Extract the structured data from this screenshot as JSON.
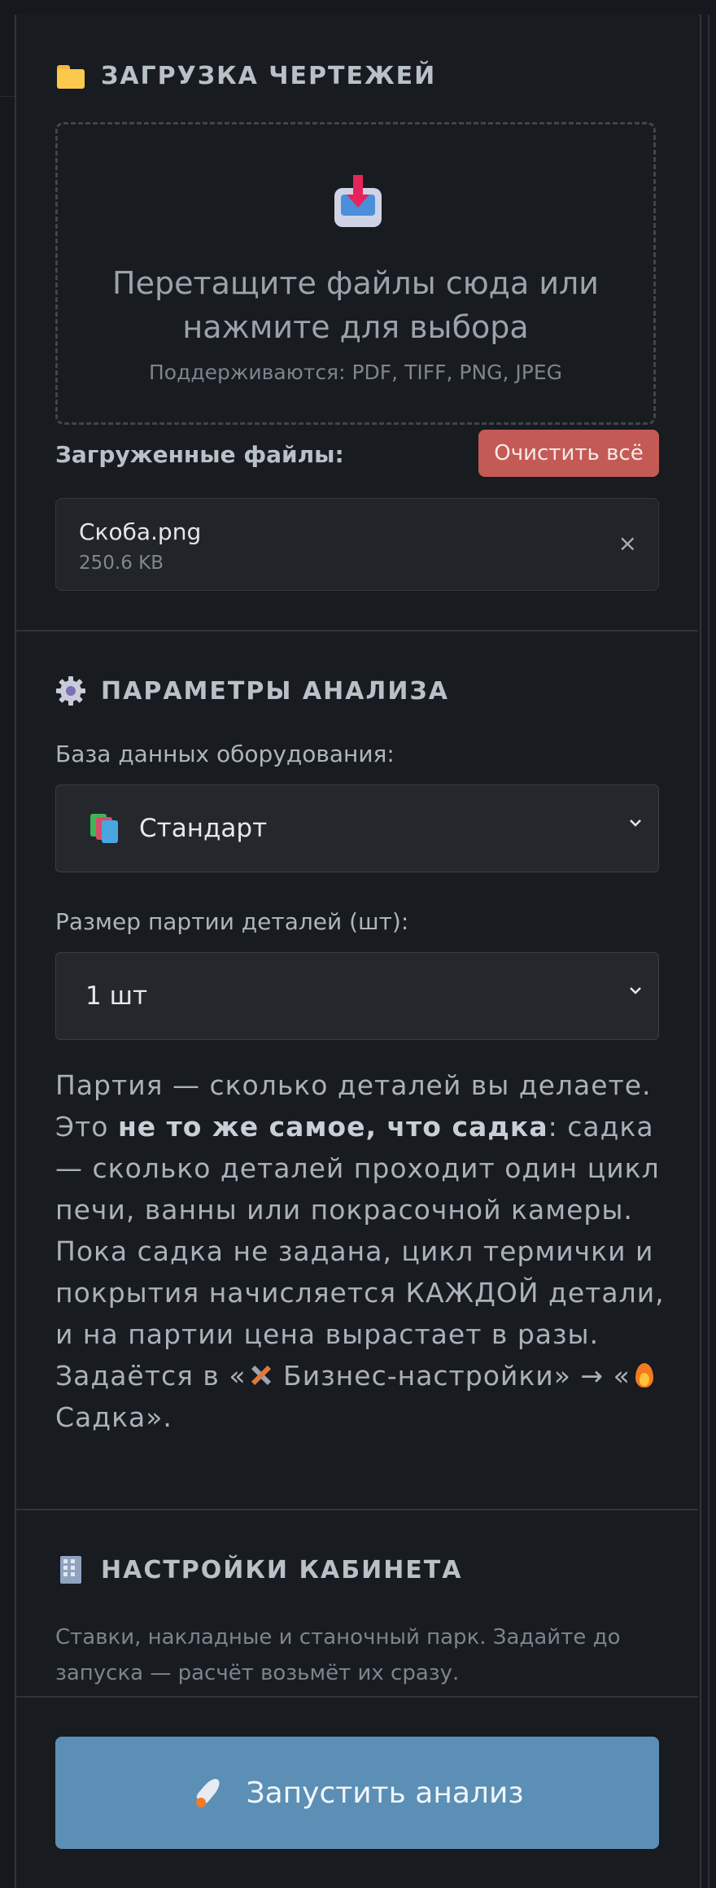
{
  "upload": {
    "title": "ЗАГРУЗКА ЧЕРТЕЖЕЙ",
    "drop_line1": "Перетащите файлы сюда или",
    "drop_line2": "нажмите для выбора",
    "supported": "Поддерживаются: PDF, TIFF, PNG, JPEG",
    "files_label": "Загруженные файлы:",
    "clear_label": "Очистить всё",
    "files": [
      {
        "name": "Скоба.png",
        "size": "250.6 KB"
      }
    ],
    "remove_glyph": "×"
  },
  "analysis": {
    "title": "ПАРАМЕТРЫ АНАЛИЗА",
    "db_label": "База данных оборудования:",
    "db_value": "Стандарт",
    "batch_label": "Размер партии деталей (шт):",
    "batch_value": "1 шт",
    "note_p1": "Партия — сколько деталей вы делаете. Это ",
    "note_bold": "не то же самое, что садка",
    "note_p2": ": садка — сколько деталей проходит один цикл печи, ванны или покрасочной камеры. Пока садка не задана, цикл термички и покрытия начисляется КАЖДОЙ детали, и на партии цена вырастает в разы. Задаётся в «",
    "note_link1": " Бизнес-настройки» → «",
    "note_link2": " Садка»."
  },
  "cabinet": {
    "title": "НАСТРОЙКИ КАБИНЕТА",
    "description": "Ставки, накладные и станочный парк. Задайте до запуска — расчёт возьмёт их сразу."
  },
  "run": {
    "label": "Запустить анализ"
  },
  "colors": {
    "accent": "#5b8fb5",
    "danger": "#c45a55",
    "background": "#181b1f"
  }
}
